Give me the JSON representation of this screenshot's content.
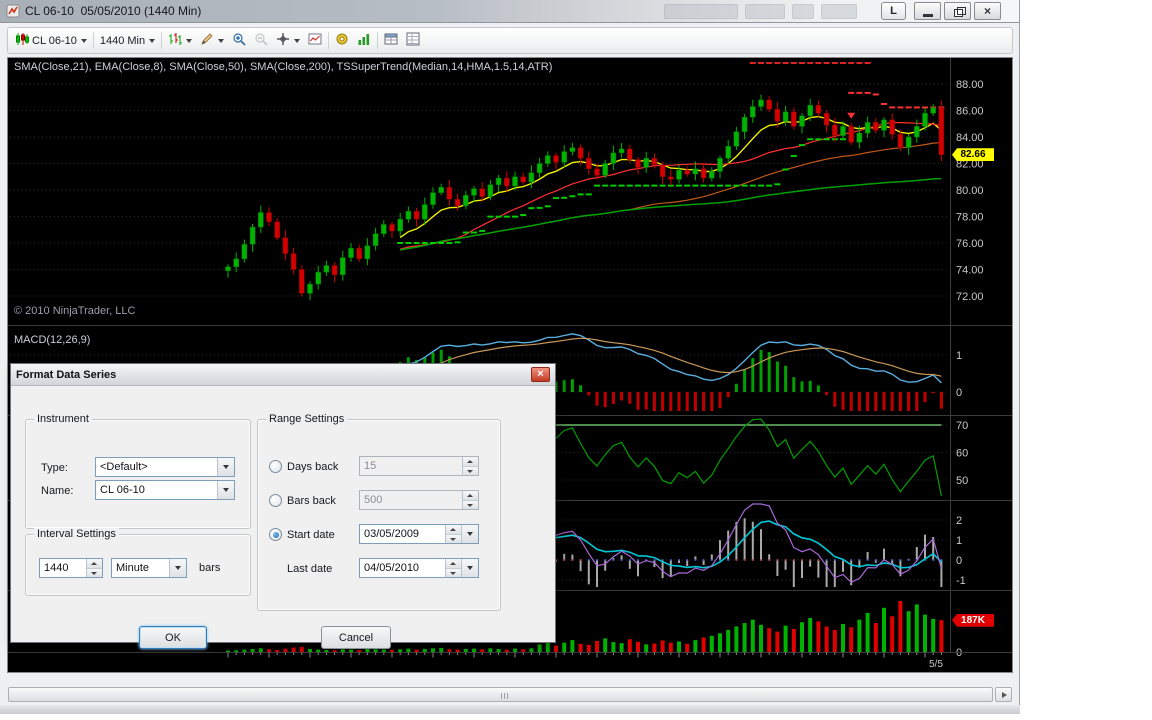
{
  "window": {
    "title": "CL 06-10  05/05/2010 (1440 Min)",
    "l_button_label": "L",
    "close_glyph": "×"
  },
  "toolbar": {
    "instrument": "CL 06-10",
    "interval": "1440 Min",
    "icon_names": [
      "mini-candles",
      "chart-style",
      "draw-tools",
      "zoom-in",
      "zoom-out",
      "crosshair",
      "snapshot",
      "strategies",
      "indicators",
      "databox",
      "properties"
    ]
  },
  "chart": {
    "indicators_label": "SMA(Close,21), EMA(Close,8), SMA(Close,50), SMA(Close,200), TSSuperTrend(Median,14,HMA,1.5,14,ATR)",
    "copyright": "© 2010 NinjaTrader, LLC",
    "macd_label": "MACD(12,26,9)"
  },
  "chart_data": {
    "type": "candlestick",
    "instrument": "CL 06-10",
    "interval": "1440 Min",
    "price_ticks": [
      {
        "v": 88,
        "t": "88.00"
      },
      {
        "v": 86,
        "t": "86.00"
      },
      {
        "v": 84,
        "t": "84.00"
      },
      {
        "v": 82,
        "t": "82.00"
      },
      {
        "v": 80,
        "t": "80.00"
      },
      {
        "v": 78,
        "t": "78.00"
      },
      {
        "v": 76,
        "t": "76.00"
      },
      {
        "v": 74,
        "t": "74.00"
      },
      {
        "v": 72,
        "t": "72.00"
      }
    ],
    "macd_ticks": [
      {
        "v": 1,
        "t": "1"
      },
      {
        "v": 0,
        "t": "0"
      }
    ],
    "rsi_ticks": [
      {
        "v": 70,
        "t": "70"
      },
      {
        "v": 60,
        "t": "60"
      },
      {
        "v": 50,
        "t": "50"
      }
    ],
    "mom_ticks": [
      {
        "v": 2,
        "t": "2"
      },
      {
        "v": 1,
        "t": "1"
      },
      {
        "v": 0,
        "t": "0"
      },
      {
        "v": -1,
        "t": "-1"
      }
    ],
    "vol_ticks": [
      {
        "v": 0,
        "t": "0"
      }
    ],
    "x_axis_last_label": "5/5",
    "last_price": 82.66,
    "last_price_label": "82.66",
    "last_volume_k": 187,
    "last_volume_label": "187K",
    "closes": [
      74.2,
      74.8,
      75.9,
      77.2,
      78.3,
      77.6,
      76.4,
      75.2,
      74.0,
      72.2,
      72.9,
      73.8,
      74.3,
      73.6,
      74.9,
      75.6,
      74.8,
      75.8,
      76.7,
      77.4,
      76.9,
      77.8,
      78.4,
      77.8,
      78.9,
      79.8,
      80.2,
      79.3,
      78.8,
      79.6,
      80.1,
      79.5,
      80.4,
      80.9,
      80.3,
      81.0,
      80.6,
      81.3,
      82.0,
      82.6,
      82.1,
      82.9,
      83.2,
      82.4,
      81.6,
      81.1,
      82.0,
      82.8,
      83.1,
      82.3,
      81.7,
      82.4,
      81.9,
      81.0,
      80.8,
      81.5,
      81.2,
      81.6,
      80.9,
      81.4,
      82.4,
      83.3,
      84.4,
      85.5,
      86.3,
      86.8,
      86.1,
      85.2,
      85.9,
      84.8,
      85.6,
      86.4,
      85.8,
      84.9,
      84.1,
      84.8,
      83.6,
      84.3,
      85.1,
      84.5,
      85.3,
      84.2,
      83.2,
      84.0,
      84.8,
      85.8,
      86.2,
      82.66
    ],
    "volumes_k": [
      8,
      10,
      14,
      18,
      22,
      16,
      12,
      20,
      26,
      30,
      18,
      14,
      12,
      10,
      16,
      14,
      12,
      18,
      16,
      14,
      12,
      16,
      20,
      14,
      18,
      22,
      24,
      16,
      14,
      18,
      20,
      16,
      22,
      18,
      14,
      20,
      16,
      22,
      45,
      60,
      38,
      55,
      70,
      48,
      42,
      65,
      80,
      58,
      52,
      75,
      60,
      45,
      50,
      68,
      55,
      62,
      48,
      70,
      85,
      95,
      110,
      130,
      150,
      170,
      190,
      160,
      140,
      120,
      155,
      135,
      175,
      200,
      180,
      150,
      130,
      165,
      145,
      190,
      230,
      170,
      260,
      210,
      300,
      240,
      280,
      220,
      195,
      187
    ],
    "colors": {
      "up": "#00b300",
      "down": "#d40000",
      "ema8": "#f0f000",
      "sma21": "#ff3030",
      "sma50": "#c05818",
      "sma200": "#00a000",
      "supertrend_up": "#00cc00",
      "supertrend_down": "#ff3030",
      "macd": "#58aede",
      "signal": "#c89858",
      "hist_up": "#00a000",
      "hist_down": "#c00000",
      "rsi": "#00a000",
      "overbought": "#80e080",
      "purple": "#a868d8",
      "cyan": "#00c8d8",
      "histgray": "#aaaaaa",
      "volup": "#00b300",
      "voldown": "#e00000",
      "badge_price": "#ffff00",
      "badge_vol": "#e00000"
    }
  },
  "dialog": {
    "title": "Format Data Series",
    "close_glyph": "×",
    "group_instrument": "Instrument",
    "group_range": "Range Settings",
    "group_interval": "Interval Settings",
    "type_label": "Type:",
    "type_value": "<Default>",
    "name_label": "Name:",
    "name_value": "CL 06-10",
    "days_back_label": "Days back",
    "days_back_value": "15",
    "bars_back_label": "Bars back",
    "bars_back_value": "500",
    "start_date_label": "Start date",
    "start_date_value": "03/05/2009",
    "last_date_label": "Last date",
    "last_date_value": "04/05/2010",
    "interval_value": "1440",
    "interval_unit": "Minute",
    "bars_suffix": "bars",
    "ok_label": "OK",
    "cancel_label": "Cancel"
  }
}
